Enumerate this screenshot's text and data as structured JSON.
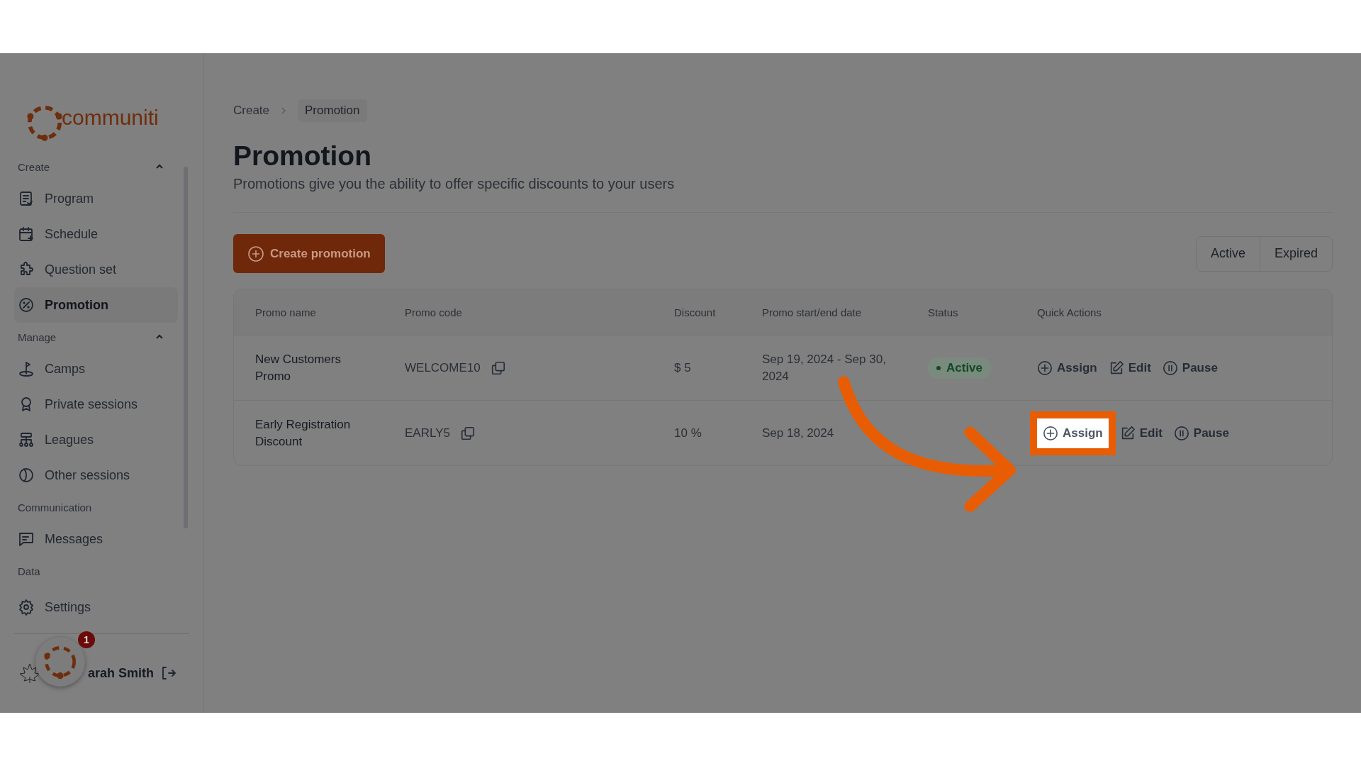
{
  "logo": {
    "text": "communiti"
  },
  "sidebar": {
    "sections": [
      {
        "label": "Create",
        "expanded": true,
        "items": [
          {
            "label": "Program",
            "selected": false
          },
          {
            "label": "Schedule",
            "selected": false
          },
          {
            "label": "Question set",
            "selected": false
          },
          {
            "label": "Promotion",
            "selected": true
          }
        ]
      },
      {
        "label": "Manage",
        "expanded": true,
        "items": [
          {
            "label": "Camps",
            "selected": false
          },
          {
            "label": "Private sessions",
            "selected": false
          },
          {
            "label": "Leagues",
            "selected": false
          },
          {
            "label": "Other sessions",
            "selected": false
          }
        ]
      },
      {
        "label": "Communication",
        "items": [
          {
            "label": "Messages",
            "selected": false
          }
        ]
      },
      {
        "label": "Data"
      }
    ],
    "footer": {
      "label": "Settings"
    }
  },
  "user": {
    "name": "arah Smith"
  },
  "help_widget": {
    "badge": "1"
  },
  "breadcrumb": [
    {
      "label": "Create",
      "selected": false
    },
    {
      "label": "Promotion",
      "selected": true
    }
  ],
  "page": {
    "title": "Promotion",
    "subtitle": "Promotions give you the ability to offer specific discounts to your users"
  },
  "create_button": "Create promotion",
  "filter_tabs": [
    "Active",
    "Expired"
  ],
  "table": {
    "columns": [
      "Promo name",
      "Promo code",
      "Discount",
      "Promo start/end date",
      "Status",
      "Quick Actions"
    ],
    "rows": [
      {
        "name": "New Customers Promo",
        "code": "WELCOME10",
        "discount": "$ 5",
        "dates": "Sep 19, 2024 - Sep 30, 2024",
        "status": "Active",
        "actions": [
          {
            "label": "Assign",
            "kind": "assign",
            "highlighted": false
          },
          {
            "label": "Edit",
            "kind": "edit",
            "highlighted": false
          },
          {
            "label": "Pause",
            "kind": "pause",
            "highlighted": false
          }
        ]
      },
      {
        "name": "Early Registration Discount",
        "code": "EARLY5",
        "discount": "10 %",
        "dates": "Sep 18, 2024",
        "actions": [
          {
            "label": "Assign",
            "kind": "assign",
            "highlighted": true
          },
          {
            "label": "Edit",
            "kind": "edit",
            "highlighted": false
          },
          {
            "label": "Pause",
            "kind": "pause",
            "highlighted": false
          }
        ]
      }
    ]
  }
}
